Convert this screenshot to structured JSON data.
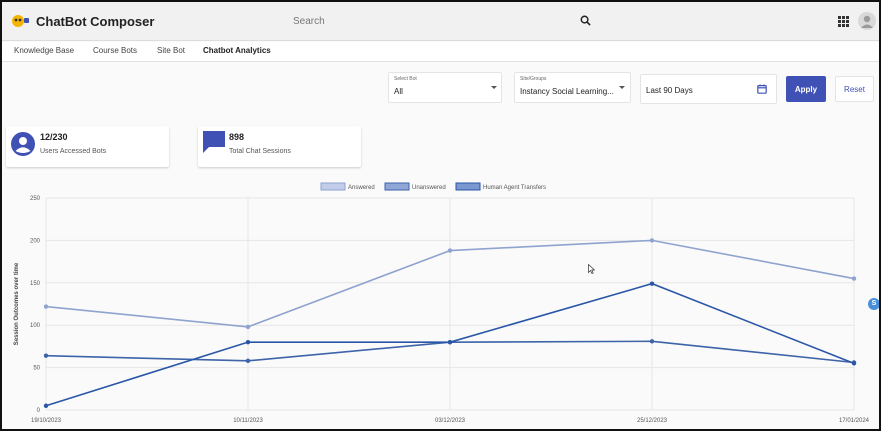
{
  "app": {
    "title": "ChatBot Composer"
  },
  "search": {
    "placeholder": "Search"
  },
  "tabs": [
    {
      "label": "Knowledge Base"
    },
    {
      "label": "Course Bots"
    },
    {
      "label": "Site Bot"
    },
    {
      "label": "Chatbot Analytics",
      "active": true
    }
  ],
  "filters": {
    "select_bot": {
      "label": "Select Bot",
      "value": "All"
    },
    "site_groups": {
      "label": "Site/Groups",
      "value": "Instancy Social Learning..."
    },
    "date_range": {
      "value": "Last 90 Days"
    },
    "apply_label": "Apply",
    "reset_label": "Reset"
  },
  "stats": [
    {
      "value": "12/230",
      "label": "Users Accessed Bots"
    },
    {
      "value": "898",
      "label": "Total Chat Sessions"
    }
  ],
  "colors": {
    "accent": "#3f51b5",
    "answered": "#8fa3cf",
    "unanswered": "#3d63a8",
    "agent": "#2a56a8"
  },
  "chart_data": {
    "type": "line",
    "x": [
      "19/10/2023",
      "10/11/2023",
      "03/12/2023",
      "25/12/2023",
      "17/01/2024"
    ],
    "ylabel": "Session Outcomes over time",
    "ylim": [
      0,
      250
    ],
    "yticks": [
      0,
      50,
      100,
      150,
      200,
      250
    ],
    "grid": true,
    "legend": "top-center",
    "series": [
      {
        "name": "Answered",
        "values": [
          122,
          98,
          188,
          200,
          155
        ]
      },
      {
        "name": "Unanswered",
        "values": [
          64,
          58,
          80,
          81,
          56
        ]
      },
      {
        "name": "Human Agent Transfers",
        "values": [
          5,
          80,
          80,
          149,
          55
        ]
      }
    ]
  }
}
